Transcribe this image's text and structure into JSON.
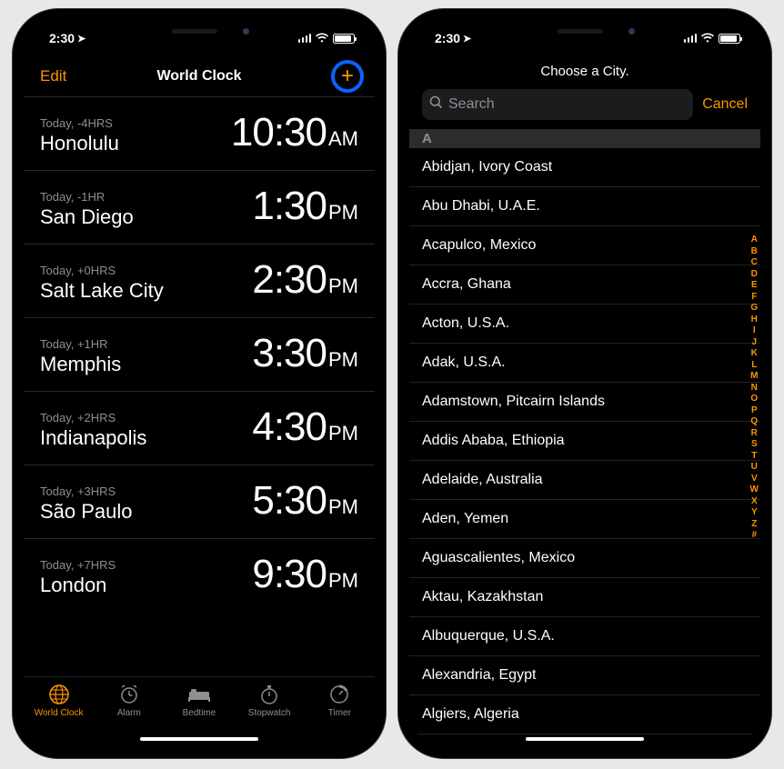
{
  "statusTime": "2:30",
  "worldClock": {
    "edit": "Edit",
    "title": "World Clock",
    "clocks": [
      {
        "offset": "Today, -4HRS",
        "city": "Honolulu",
        "time": "10:30",
        "ampm": "AM"
      },
      {
        "offset": "Today, -1HR",
        "city": "San Diego",
        "time": "1:30",
        "ampm": "PM"
      },
      {
        "offset": "Today, +0HRS",
        "city": "Salt Lake City",
        "time": "2:30",
        "ampm": "PM"
      },
      {
        "offset": "Today, +1HR",
        "city": "Memphis",
        "time": "3:30",
        "ampm": "PM"
      },
      {
        "offset": "Today, +2HRS",
        "city": "Indianapolis",
        "time": "4:30",
        "ampm": "PM"
      },
      {
        "offset": "Today, +3HRS",
        "city": "São Paulo",
        "time": "5:30",
        "ampm": "PM"
      },
      {
        "offset": "Today, +7HRS",
        "city": "London",
        "time": "9:30",
        "ampm": "PM"
      }
    ],
    "tabs": {
      "worldClock": "World Clock",
      "alarm": "Alarm",
      "bedtime": "Bedtime",
      "stopwatch": "Stopwatch",
      "timer": "Timer"
    }
  },
  "chooseCity": {
    "title": "Choose a City.",
    "searchPlaceholder": "Search",
    "cancel": "Cancel",
    "sectionLetter": "A",
    "cities": [
      "Abidjan, Ivory Coast",
      "Abu Dhabi, U.A.E.",
      "Acapulco, Mexico",
      "Accra, Ghana",
      "Acton, U.S.A.",
      "Adak, U.S.A.",
      "Adamstown, Pitcairn Islands",
      "Addis Ababa, Ethiopia",
      "Adelaide, Australia",
      "Aden, Yemen",
      "Aguascalientes, Mexico",
      "Aktau, Kazakhstan",
      "Albuquerque, U.S.A.",
      "Alexandria, Egypt",
      "Algiers, Algeria"
    ],
    "index": [
      "A",
      "B",
      "C",
      "D",
      "E",
      "F",
      "G",
      "H",
      "I",
      "J",
      "K",
      "L",
      "M",
      "N",
      "O",
      "P",
      "Q",
      "R",
      "S",
      "T",
      "U",
      "V",
      "W",
      "X",
      "Y",
      "Z",
      "#"
    ]
  }
}
